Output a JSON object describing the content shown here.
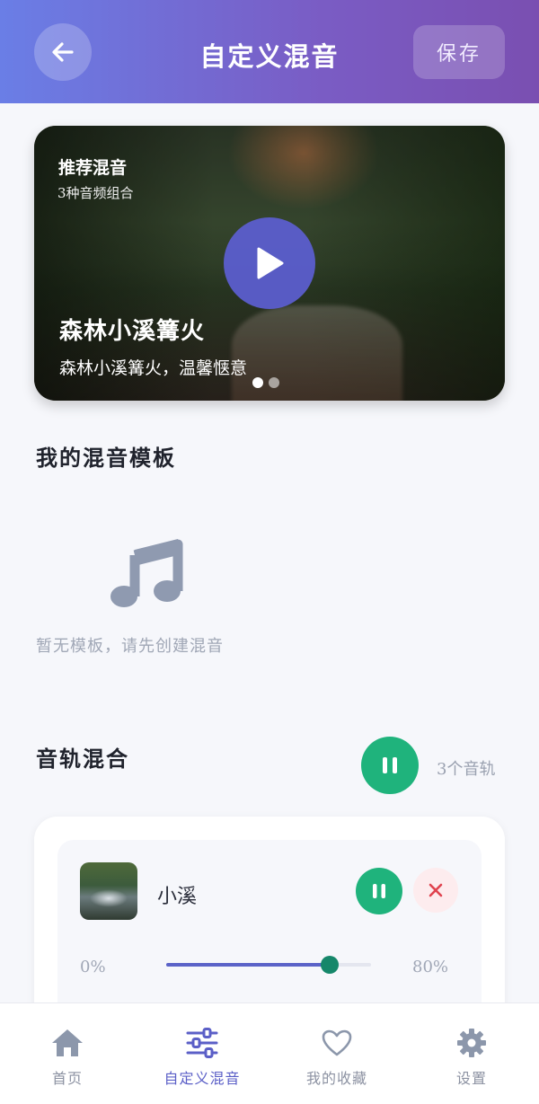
{
  "header": {
    "title": "自定义混音",
    "save_label": "保存",
    "back_icon": "arrow-left-icon"
  },
  "banner": {
    "tag": "推荐混音",
    "subtitle": "3种音频组合",
    "title": "森林小溪篝火",
    "description": "森林小溪篝火，温馨惬意",
    "play_icon": "play-icon",
    "page_count": 2,
    "active_page": 1
  },
  "templates": {
    "title": "我的混音模板",
    "empty_icon": "music-note-icon",
    "empty_text": "暂无模板，请先创建混音"
  },
  "mix": {
    "title": "音轨混合",
    "track_count": "3个音轨",
    "tracks": [
      {
        "name": "小溪",
        "volume_min": "0%",
        "volume_max": "80%",
        "volume": 0.8,
        "state": "playing"
      }
    ]
  },
  "nav": {
    "items": [
      {
        "label": "首页",
        "icon": "home-icon",
        "active": false
      },
      {
        "label": "自定义混音",
        "icon": "sliders-icon",
        "active": true
      },
      {
        "label": "我的收藏",
        "icon": "heart-icon",
        "active": false
      },
      {
        "label": "设置",
        "icon": "gear-icon",
        "active": false
      }
    ]
  },
  "colors": {
    "accent": "#5b5fc7",
    "play_green": "#1fb37c",
    "danger": "#e0434f"
  }
}
